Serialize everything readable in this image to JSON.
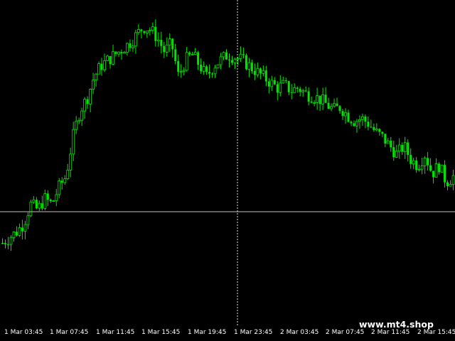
{
  "watermark": "www.mt4.shop",
  "colors": {
    "background": "#000000",
    "candle": "#00e600",
    "crosshair": "#c0c0c0",
    "text": "#ffffff"
  },
  "chart_data": {
    "type": "candlestick",
    "title": "",
    "xlabel": "",
    "ylabel": "",
    "grid": false,
    "legend": "none",
    "x_ticks": [
      "1 Mar 03:45",
      "1 Mar 07:45",
      "1 Mar 11:45",
      "1 Mar 15:45",
      "1 Mar 19:45",
      "1 Mar 23:45",
      "2 Mar 03:45",
      "2 Mar 07:45",
      "2 Mar 11:45",
      "2 Mar 15:45"
    ],
    "close_profile": [
      20,
      22,
      24,
      27,
      34,
      32,
      36,
      34,
      40,
      44,
      58,
      68,
      72,
      80,
      84,
      86,
      88,
      90,
      92,
      95,
      98,
      97,
      94,
      89,
      92,
      80,
      86,
      88,
      84,
      80,
      84,
      86,
      88,
      87,
      86,
      84,
      82,
      80,
      78,
      76,
      77,
      75,
      76,
      74,
      73,
      72,
      70,
      68,
      69,
      66,
      64,
      65,
      63,
      60,
      58,
      55,
      52,
      55,
      50,
      48,
      52,
      45,
      48,
      42,
      44
    ]
  }
}
